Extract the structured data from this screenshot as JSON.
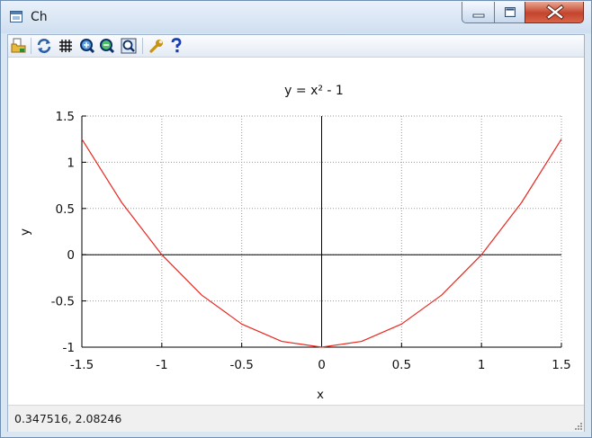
{
  "window": {
    "title": "Ch"
  },
  "toolbar": {
    "icons": [
      "open-folder-icon",
      "refresh-icon",
      "grid-icon",
      "zoom-in-icon",
      "zoom-out-icon",
      "zoom-fit-icon",
      "wrench-icon",
      "help-icon"
    ]
  },
  "status": {
    "coordinates": "0.347516,  2.08246"
  },
  "colors": {
    "curve": "#e8271f",
    "axis": "#000000",
    "grid": "#9a9a9a"
  },
  "chart_data": {
    "type": "line",
    "title": "y = x² - 1",
    "xlabel": "x",
    "ylabel": "y",
    "xlim": [
      -1.5,
      1.5
    ],
    "ylim": [
      -1,
      1.5
    ],
    "xticks": [
      -1.5,
      -1,
      -0.5,
      0,
      0.5,
      1,
      1.5
    ],
    "xtick_labels": [
      "-1.5",
      "-1",
      "-0.5",
      "0",
      "0.5",
      "1",
      "1.5"
    ],
    "yticks": [
      -1,
      -0.5,
      0,
      0.5,
      1,
      1.5
    ],
    "ytick_labels": [
      "-1",
      "-0.5",
      "0",
      "0.5",
      "1",
      "1.5"
    ],
    "grid": true,
    "series": [
      {
        "x": [
          -1.5,
          -1.25,
          -1.0,
          -0.75,
          -0.5,
          -0.25,
          0.0,
          0.25,
          0.5,
          0.75,
          1.0,
          1.25,
          1.5
        ],
        "y": [
          1.25,
          0.5625,
          0.0,
          -0.4375,
          -0.75,
          -0.9375,
          -1.0,
          -0.9375,
          -0.75,
          -0.4375,
          0.0,
          0.5625,
          1.25
        ]
      }
    ]
  }
}
